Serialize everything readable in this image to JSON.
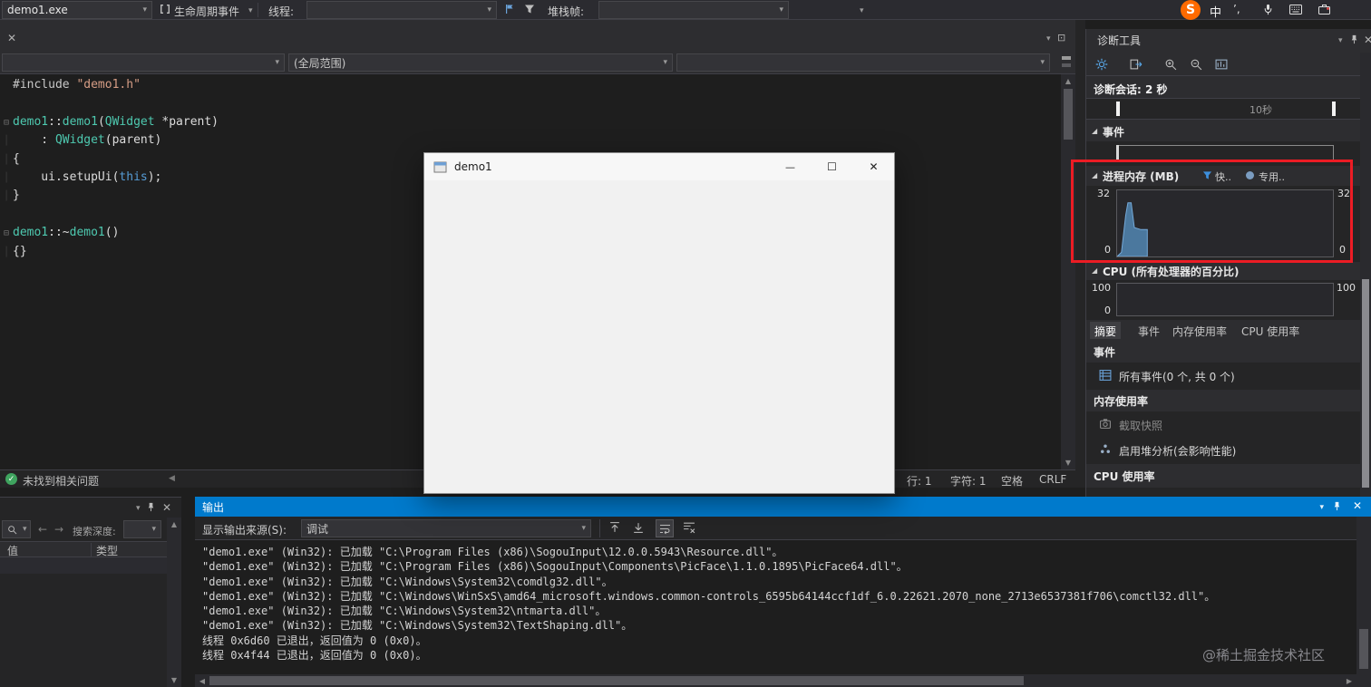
{
  "top_toolbar": {
    "process_name": "demo1.exe",
    "lifecycle_events_label": "生命周期事件",
    "thread_label": "线程:",
    "stack_frame_label": "堆栈帧:"
  },
  "input_tray": {
    "ime_mode": "中",
    "ime_punct": "’,"
  },
  "editor": {
    "nav_scope": "(全局范围)",
    "code_lines": [
      {
        "gutter": "",
        "tokens": [
          {
            "t": "#include ",
            "c": "pp"
          },
          {
            "t": "\"demo1.h\"",
            "c": "str"
          }
        ]
      },
      {
        "gutter": "",
        "tokens": []
      },
      {
        "gutter": "fold",
        "tokens": [
          {
            "t": "demo1",
            "c": "type"
          },
          {
            "t": "::",
            "c": "plain"
          },
          {
            "t": "demo1",
            "c": "type"
          },
          {
            "t": "(",
            "c": "plain"
          },
          {
            "t": "QWidget",
            "c": "type"
          },
          {
            "t": " *parent)",
            "c": "plain"
          }
        ]
      },
      {
        "gutter": "line",
        "tokens": [
          {
            "t": "    : ",
            "c": "plain"
          },
          {
            "t": "QWidget",
            "c": "type"
          },
          {
            "t": "(parent)",
            "c": "plain"
          }
        ]
      },
      {
        "gutter": "line",
        "tokens": [
          {
            "t": "{",
            "c": "plain"
          }
        ]
      },
      {
        "gutter": "line",
        "tokens": [
          {
            "t": "    ui.",
            "c": "plain"
          },
          {
            "t": "setupUi",
            "c": "fn"
          },
          {
            "t": "(",
            "c": "plain"
          },
          {
            "t": "this",
            "c": "kw"
          },
          {
            "t": ");",
            "c": "plain"
          }
        ]
      },
      {
        "gutter": "line",
        "tokens": [
          {
            "t": "}",
            "c": "plain"
          }
        ]
      },
      {
        "gutter": "",
        "tokens": []
      },
      {
        "gutter": "fold",
        "tokens": [
          {
            "t": "demo1",
            "c": "type"
          },
          {
            "t": "::~",
            "c": "plain"
          },
          {
            "t": "demo1",
            "c": "type"
          },
          {
            "t": "()",
            "c": "plain"
          }
        ]
      },
      {
        "gutter": "line",
        "tokens": [
          {
            "t": "{}",
            "c": "plain"
          }
        ]
      }
    ],
    "status_bar": {
      "problems": "未找到相关问题",
      "line": "行: 1",
      "column": "字符: 1",
      "spaces": "空格",
      "line_ending": "CRLF"
    }
  },
  "qt_window": {
    "title": "demo1",
    "minimize": "—",
    "maximize": "☐",
    "close": "✕"
  },
  "diagnostics": {
    "title": "诊断工具",
    "session_label": "诊断会话: 2 秒",
    "ruler_mark": "10秒",
    "sections": {
      "events": "事件",
      "memory": "进程内存 (MB)",
      "cpu": "CPU (所有处理器的百分比)"
    },
    "memory_legend": {
      "snapshot": "快..",
      "private": "专用.."
    },
    "memory_axis": {
      "max": "32",
      "min": "0"
    },
    "cpu_axis": {
      "max": "100",
      "min": "0"
    },
    "tabs": [
      "摘要",
      "事件",
      "内存使用率",
      "CPU 使用率"
    ],
    "summary": {
      "events_header": "事件",
      "all_events": "所有事件(0 个, 共 0 个)",
      "memory_header": "内存使用率",
      "take_snapshot": "截取快照",
      "enable_heap": "启用堆分析(会影响性能)",
      "cpu_header": "CPU 使用率"
    }
  },
  "watch_panel": {
    "search_depth_label": "搜索深度:",
    "columns": [
      "值",
      "类型"
    ]
  },
  "output_panel": {
    "title": "输出",
    "source_label": "显示输出来源(S):",
    "source_value": "调试",
    "lines": [
      "\"demo1.exe\" (Win32): 已加载 \"C:\\Program Files (x86)\\SogouInput\\12.0.0.5943\\Resource.dll\"。",
      "\"demo1.exe\" (Win32): 已加载 \"C:\\Program Files (x86)\\SogouInput\\Components\\PicFace\\1.1.0.1895\\PicFace64.dll\"。",
      "\"demo1.exe\" (Win32): 已加载 \"C:\\Windows\\System32\\comdlg32.dll\"。",
      "\"demo1.exe\" (Win32): 已加载 \"C:\\Windows\\WinSxS\\amd64_microsoft.windows.common-controls_6595b64144ccf1df_6.0.22621.2070_none_2713e6537381f706\\comctl32.dll\"。",
      "\"demo1.exe\" (Win32): 已加载 \"C:\\Windows\\System32\\ntmarta.dll\"。",
      "\"demo1.exe\" (Win32): 已加载 \"C:\\Windows\\System32\\TextShaping.dll\"。",
      "线程 0x6d60 已退出，返回值为 0 (0x0)。",
      "线程 0x4f44 已退出，返回值为 0 (0x0)。"
    ]
  },
  "watermark": "@稀土掘金技术社区",
  "colors": {
    "accent_blue": "#007acc",
    "annotation_red": "#ec1c24",
    "memory_fill": "#4f81ab"
  },
  "chart_data": [
    {
      "type": "area",
      "title": "进程内存 (MB)",
      "x_seconds": [
        0,
        0.2,
        0.4,
        0.5,
        0.65,
        0.8,
        1.1,
        1.4
      ],
      "values": [
        0,
        2,
        20,
        26,
        26,
        14,
        13,
        13
      ],
      "ylabel": "MB",
      "ylim": [
        0,
        32
      ],
      "xlim": [
        0,
        10
      ],
      "legend": [
        "快照",
        "专用工作集"
      ],
      "grid": false
    },
    {
      "type": "area",
      "title": "CPU (所有处理器的百分比)",
      "x_seconds": [
        0,
        2
      ],
      "values": [
        0,
        0
      ],
      "ylim": [
        0,
        100
      ],
      "xlim": [
        0,
        10
      ],
      "grid": false
    }
  ]
}
